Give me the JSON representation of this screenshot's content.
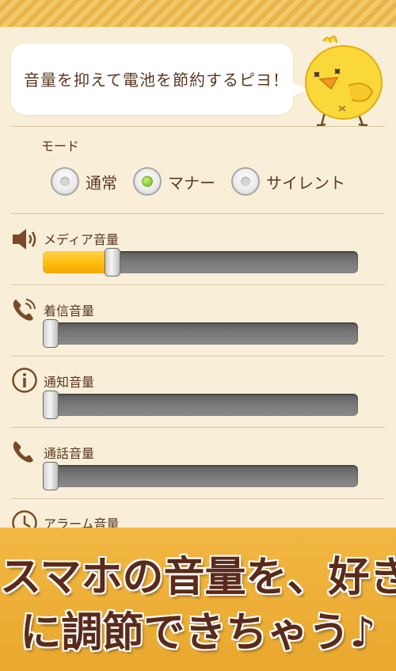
{
  "bubble": {
    "message": "音量を抑えて電池を節約するピヨ！"
  },
  "mode": {
    "label": "モード",
    "options": [
      {
        "label": "通常",
        "selected": false
      },
      {
        "label": "マナー",
        "selected": true
      },
      {
        "label": "サイレント",
        "selected": false
      }
    ]
  },
  "volumes": [
    {
      "label": "メディア音量",
      "icon": "speaker-icon",
      "level": 0.22
    },
    {
      "label": "着信音量",
      "icon": "ringing-phone-icon",
      "level": 0.0
    },
    {
      "label": "通知音量",
      "icon": "info-icon",
      "level": 0.0
    },
    {
      "label": "通話音量",
      "icon": "phone-icon",
      "level": 0.0
    },
    {
      "label": "アラーム音量",
      "icon": "clock-icon"
    }
  ],
  "banner": {
    "line1": "スマホの音量を、好き",
    "line2": "に調節できちゃう♪"
  },
  "colors": {
    "background": "#f9efd9",
    "accent": "#ffbe10",
    "text": "#5a3620",
    "banner": "#f2b743"
  }
}
